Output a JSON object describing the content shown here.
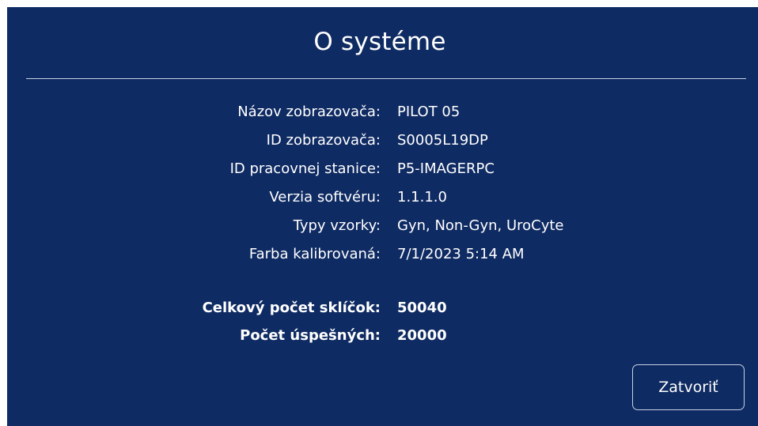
{
  "dialog": {
    "title": "O systéme",
    "info": [
      {
        "label": "Názov zobrazovača:",
        "value": "PILOT 05"
      },
      {
        "label": "ID zobrazovača:",
        "value": "S0005L19DP"
      },
      {
        "label": "ID pracovnej stanice:",
        "value": "P5-IMAGERPC"
      },
      {
        "label": "Verzia softvéru:",
        "value": "1.1.1.0"
      },
      {
        "label": "Typy vzorky:",
        "value": "Gyn, Non-Gyn, UroCyte"
      },
      {
        "label": "Farba kalibrovaná:",
        "value": "7/1/2023 5:14 AM"
      }
    ],
    "stats": [
      {
        "label": "Celkový počet sklíčok:",
        "value": "50040"
      },
      {
        "label": "Počet úspešných:",
        "value": "20000"
      }
    ],
    "close_label": "Zatvoriť"
  },
  "colors": {
    "background": "#0f2b63",
    "text": "#ffffff",
    "border": "#c9d1e3"
  }
}
